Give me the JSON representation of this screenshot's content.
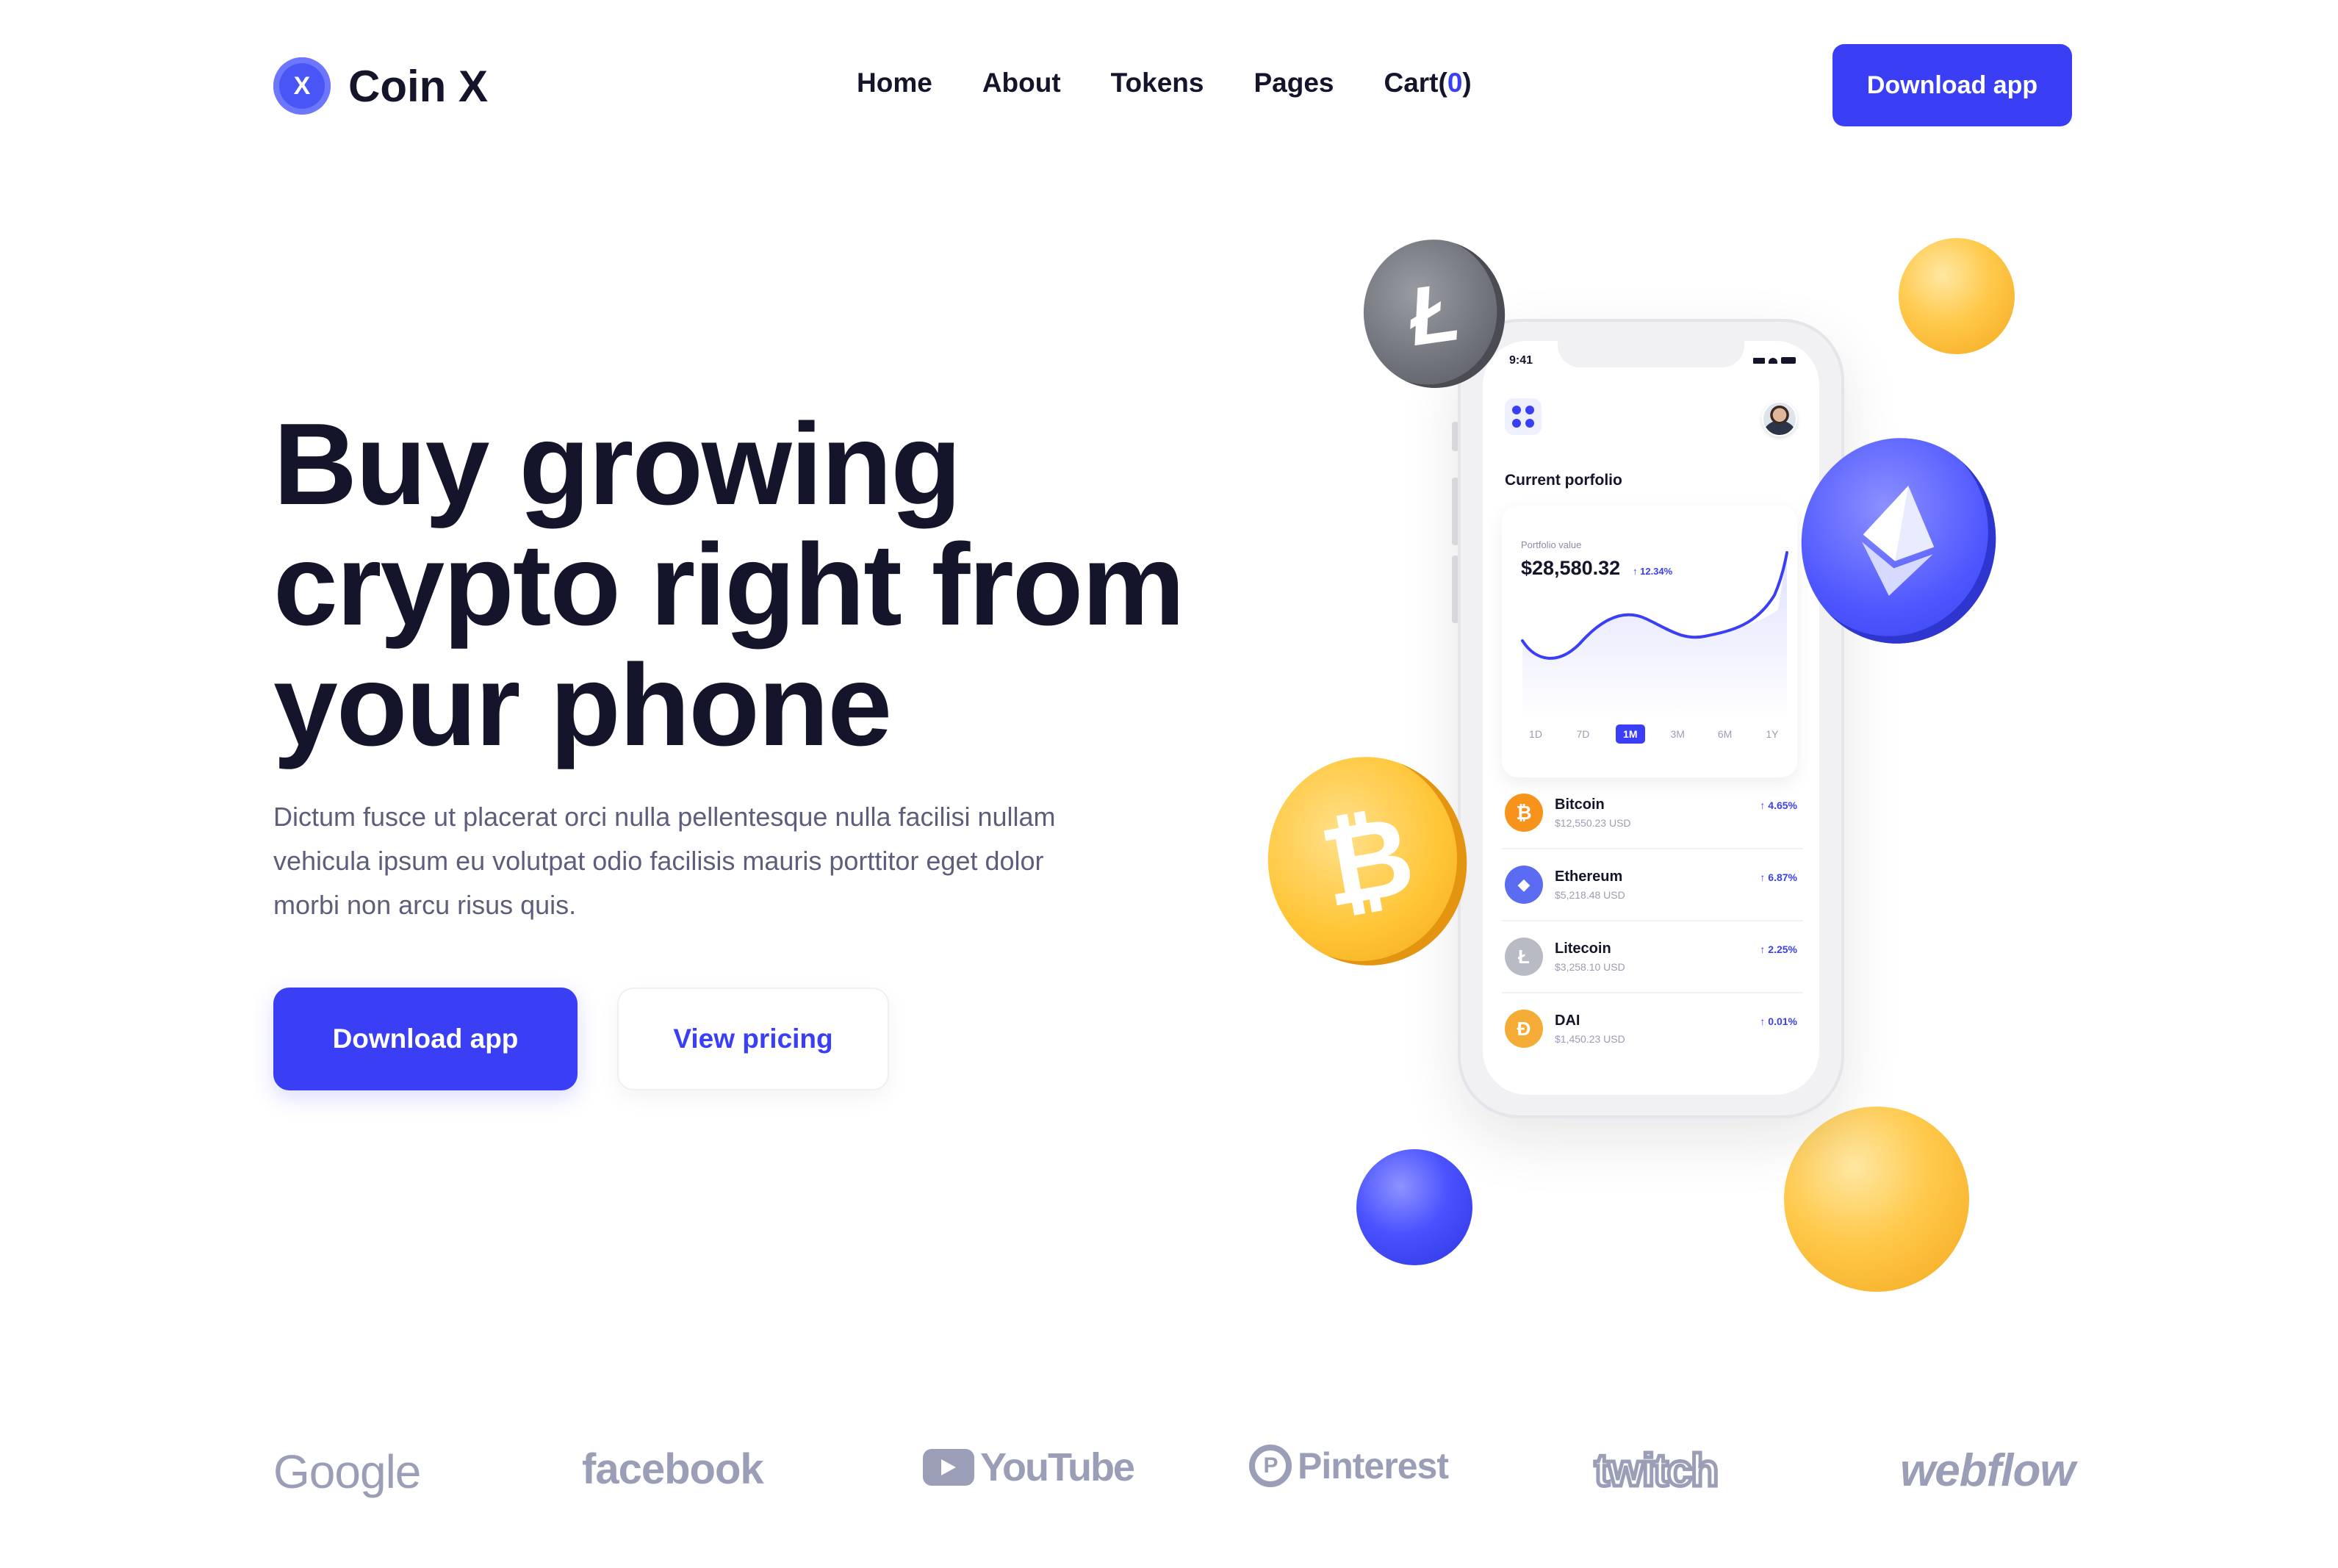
{
  "brand": {
    "name": "Coin X",
    "mark": "X",
    "accent": "#3a3ff5",
    "text_color": "#14142b"
  },
  "nav": {
    "items": [
      "Home",
      "About",
      "Tokens",
      "Pages"
    ],
    "cart_label": "Cart(",
    "cart_count": "0",
    "cart_close": ")",
    "cta": "Download app"
  },
  "hero": {
    "title": "Buy growing crypto right from your phone",
    "description": "Dictum fusce ut placerat orci nulla pellentesque nulla facilisi nullam vehicula ipsum eu volutpat odio facilisis mauris porttitor eget dolor morbi non arcu risus quis.",
    "primary_button": "Download app",
    "secondary_button": "View pricing"
  },
  "phone": {
    "status_time": "9:41",
    "heading": "Current porfolio",
    "portfolio_label": "Portfolio value",
    "portfolio_value": "$28,580.32",
    "portfolio_change": "↑ 12.34%",
    "ranges": [
      "1D",
      "7D",
      "1M",
      "3M",
      "6M",
      "1Y"
    ],
    "active_range": "1M",
    "coins": [
      {
        "name": "Bitcoin",
        "price": "$12,550.23 USD",
        "change": "↑ 4.65%",
        "color": "#f7931a",
        "icon": "bitcoin-icon",
        "glyph": "₿"
      },
      {
        "name": "Ethereum",
        "price": "$5,218.48 USD",
        "change": "↑ 6.87%",
        "color": "#5b6cf2",
        "icon": "ethereum-icon",
        "glyph": "◆"
      },
      {
        "name": "Litecoin",
        "price": "$3,258.10 USD",
        "change": "↑ 2.25%",
        "color": "#b8bac4",
        "icon": "litecoin-icon",
        "glyph": "Ł"
      },
      {
        "name": "DAI",
        "price": "$1,450.23 USD",
        "change": "↑ 0.01%",
        "color": "#f5ac37",
        "icon": "dai-icon",
        "glyph": "Ð"
      }
    ]
  },
  "decor": {
    "ltc_glyph": "Ł",
    "btc_glyph": "₿",
    "eth_glyph": "◆"
  },
  "logos": [
    "Google",
    "facebook",
    "YouTube",
    "Pinterest",
    "twitch",
    "webflow"
  ]
}
